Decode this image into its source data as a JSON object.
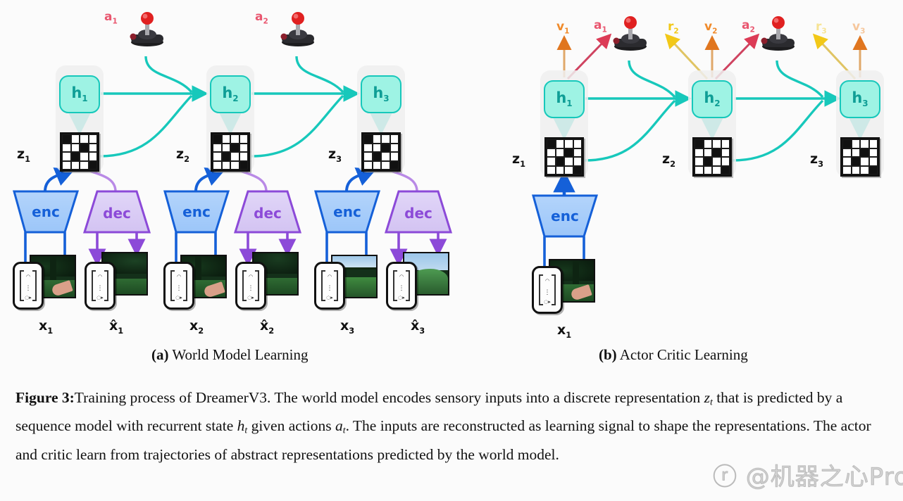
{
  "figure": {
    "number_label": "Figure 3:",
    "caption_part1": "Training process of DreamerV3. The world model encodes sensory inputs into a discrete representation ",
    "caption_z": "z",
    "caption_z_sub": "t",
    "caption_part2": " that is predicted by a sequence model with recurrent state ",
    "caption_h": "h",
    "caption_h_sub": "t",
    "caption_part3": " given actions ",
    "caption_a": "a",
    "caption_a_sub": "t",
    "caption_part4": ". The inputs are reconstructed as learning signal to shape the representations. The actor and critic learn from trajectories of abstract representations predicted by the world model."
  },
  "subcaptions": {
    "left_tag": "(a)",
    "left_text": " World Model Learning",
    "right_tag": "(b)",
    "right_text": " Actor Critic Learning"
  },
  "panel_a": {
    "name": "World Model Learning",
    "steps": [
      {
        "h_label": "h",
        "h_sub": "1",
        "z_label": "z",
        "z_sub": "1",
        "action_label": "a",
        "action_sub": "1",
        "encoder_label": "enc",
        "decoder_label": "dec",
        "input_label": "x",
        "input_sub": "1",
        "recon_label": "x̂",
        "recon_sub": "1",
        "z_pattern": [
          [
            1,
            0,
            0,
            0
          ],
          [
            0,
            0,
            1,
            0
          ],
          [
            0,
            1,
            0,
            0
          ],
          [
            0,
            0,
            0,
            1
          ]
        ]
      },
      {
        "h_label": "h",
        "h_sub": "2",
        "z_label": "z",
        "z_sub": "2",
        "action_label": "a",
        "action_sub": "2",
        "encoder_label": "enc",
        "decoder_label": "dec",
        "input_label": "x",
        "input_sub": "2",
        "recon_label": "x̂",
        "recon_sub": "2",
        "z_pattern": [
          [
            1,
            0,
            0,
            0
          ],
          [
            0,
            0,
            1,
            0
          ],
          [
            0,
            1,
            0,
            0
          ],
          [
            0,
            0,
            0,
            1
          ]
        ]
      },
      {
        "h_label": "h",
        "h_sub": "3",
        "z_label": "z",
        "z_sub": "3",
        "action_label": "",
        "action_sub": "",
        "encoder_label": "enc",
        "decoder_label": "dec",
        "input_label": "x",
        "input_sub": "3",
        "recon_label": "x̂",
        "recon_sub": "3",
        "z_pattern": [
          [
            1,
            0,
            0,
            0
          ],
          [
            0,
            0,
            1,
            0
          ],
          [
            0,
            1,
            0,
            0
          ],
          [
            0,
            0,
            0,
            1
          ]
        ]
      }
    ]
  },
  "panel_b": {
    "name": "Actor Critic Learning",
    "steps": [
      {
        "h_label": "h",
        "h_sub": "1",
        "z_label": "z",
        "z_sub": "1",
        "value_label": "v",
        "value_sub": "1",
        "action_label": "a",
        "action_sub": "1",
        "reward_label": "",
        "reward_sub": "",
        "encoder_label": "enc",
        "input_label": "x",
        "input_sub": "1",
        "z_pattern": [
          [
            1,
            0,
            0,
            0
          ],
          [
            0,
            0,
            1,
            0
          ],
          [
            0,
            1,
            0,
            0
          ],
          [
            0,
            0,
            0,
            1
          ]
        ]
      },
      {
        "h_label": "h",
        "h_sub": "2",
        "z_label": "z",
        "z_sub": "2",
        "value_label": "v",
        "value_sub": "2",
        "action_label": "a",
        "action_sub": "2",
        "reward_label": "r",
        "reward_sub": "2",
        "z_pattern": [
          [
            1,
            0,
            0,
            0
          ],
          [
            0,
            0,
            1,
            0
          ],
          [
            0,
            1,
            0,
            0
          ],
          [
            0,
            0,
            0,
            1
          ]
        ]
      },
      {
        "h_label": "h",
        "h_sub": "3",
        "z_label": "z",
        "z_sub": "3",
        "value_label": "v",
        "value_sub": "3",
        "action_label": "",
        "action_sub": "",
        "reward_label": "r",
        "reward_sub": "3",
        "z_pattern": [
          [
            1,
            0,
            0,
            0
          ],
          [
            0,
            0,
            1,
            0
          ],
          [
            0,
            1,
            0,
            0
          ],
          [
            0,
            0,
            0,
            1
          ]
        ]
      }
    ]
  },
  "icons": {
    "joystick": "joystick-icon",
    "image_thumb": "observation-thumbnail",
    "vector_card": "vector-bracket-card"
  },
  "colors": {
    "recurrent_teal": "#17c8bb",
    "recurrent_fill": "#9ef3e4",
    "encoder_blue": "#1560d8",
    "encoder_fill": "#a9cdfa",
    "decoder_purple": "#8c4ad8",
    "decoder_fill": "#ddd0f5",
    "action_crimson": "#e9566f",
    "value_orange": "#f08a2a",
    "reward_yellow": "#f2c818",
    "strip_gray": "#eeeeee",
    "page_bg": "#fbfbfb"
  },
  "watermark": {
    "text": "ⓡ @机器之心Pro"
  }
}
